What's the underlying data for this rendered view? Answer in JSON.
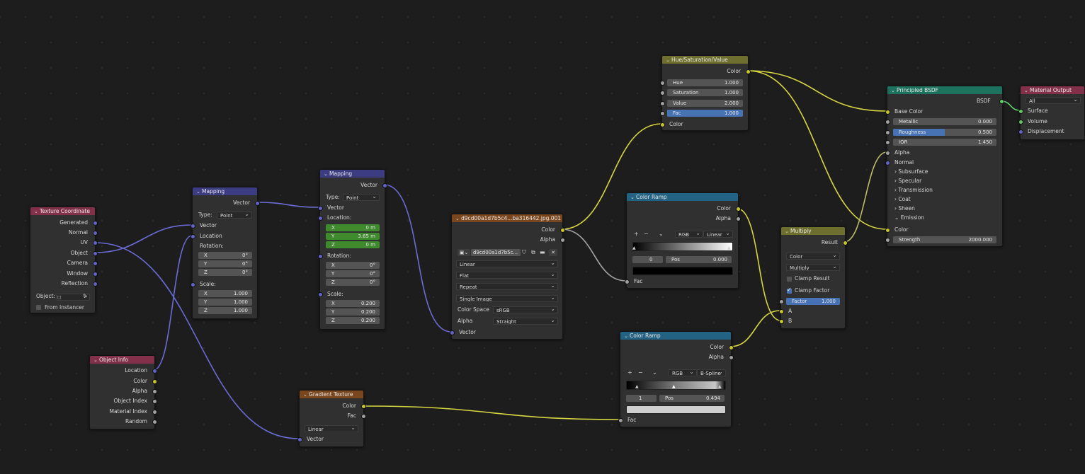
{
  "nodes": {
    "texcoord": {
      "title": "Texture Coordinate",
      "outputs": [
        "Generated",
        "Normal",
        "UV",
        "Object",
        "Camera",
        "Window",
        "Reflection"
      ],
      "object_label": "Object:",
      "from_instancer": "From Instancer"
    },
    "objinfo": {
      "title": "Object Info",
      "outputs": [
        "Location",
        "Color",
        "Alpha",
        "Object Index",
        "Material Index",
        "Random"
      ]
    },
    "mapping1": {
      "title": "Mapping",
      "out_vector": "Vector",
      "type_label": "Type:",
      "type_value": "Point",
      "in_vector": "Vector",
      "location": "Location",
      "rotation": "Rotation:",
      "rot": {
        "x": "0°",
        "y": "0°",
        "z": "0°"
      },
      "scale_label": "Scale:",
      "scale": {
        "x": "1.000",
        "y": "1.000",
        "z": "1.000"
      }
    },
    "mapping2": {
      "title": "Mapping",
      "out_vector": "Vector",
      "type_label": "Type:",
      "type_value": "Point",
      "in_vector": "Vector",
      "location": "Location:",
      "loc": {
        "x": "0 m",
        "y": "3.65 m",
        "z": "0 m"
      },
      "rotation": "Rotation:",
      "rot": {
        "x": "0°",
        "y": "0°",
        "z": "0°"
      },
      "scale_label": "Scale:",
      "scale": {
        "x": "0.200",
        "y": "0.200",
        "z": "0.200"
      }
    },
    "image": {
      "title": "d9cd00a1d7b5c4...ba316442.jpg.001",
      "out_color": "Color",
      "out_alpha": "Alpha",
      "image_name": "d9cd00a1d7b5c...",
      "interpolation": "Linear",
      "projection": "Flat",
      "extension": "Repeat",
      "source": "Single Image",
      "colorspace_label": "Color Space",
      "colorspace": "sRGB",
      "alpha_label": "Alpha",
      "alpha": "Straight",
      "in_vector": "Vector"
    },
    "gradient": {
      "title": "Gradient Texture",
      "out_color": "Color",
      "out_fac": "Fac",
      "type": "Linear",
      "in_vector": "Vector"
    },
    "hsv": {
      "title": "Hue/Saturation/Value",
      "out_color": "Color",
      "hue_label": "Hue",
      "hue": "1.000",
      "sat_label": "Saturation",
      "sat": "1.000",
      "val_label": "Value",
      "val": "2.000",
      "fac_label": "Fac",
      "fac": "1.000",
      "in_color": "Color"
    },
    "ramp1": {
      "title": "Color Ramp",
      "out_color": "Color",
      "out_alpha": "Alpha",
      "mode": "RGB",
      "interp": "Linear",
      "stop_index": "0",
      "pos_label": "Pos",
      "pos": "0.000",
      "in_fac": "Fac",
      "swatch_color": "#000000"
    },
    "ramp2": {
      "title": "Color Ramp",
      "out_color": "Color",
      "out_alpha": "Alpha",
      "mode": "RGB",
      "interp": "B-Spline",
      "stop_index": "1",
      "pos_label": "Pos",
      "pos": "0.494",
      "in_fac": "Fac",
      "swatch_color": "#cfcfcf"
    },
    "multiply": {
      "title": "Multiply",
      "out_result": "Result",
      "data_type": "Color",
      "blend": "Multiply",
      "clamp_result": "Clamp Result",
      "clamp_factor": "Clamp Factor",
      "factor_label": "Factor",
      "factor": "1.000",
      "in_a": "A",
      "in_b": "B"
    },
    "bsdf": {
      "title": "Principled BSDF",
      "out_bsdf": "BSDF",
      "base_color": "Base Color",
      "metallic_label": "Metallic",
      "metallic": "0.000",
      "roughness_label": "Roughness",
      "roughness": "0.500",
      "roughness_fill": 0.5,
      "ior_label": "IOR",
      "ior": "1.450",
      "alpha": "Alpha",
      "normal": "Normal",
      "panels": [
        "Subsurface",
        "Specular",
        "Transmission",
        "Coat",
        "Sheen"
      ],
      "emission": "Emission",
      "em_color": "Color",
      "strength_label": "Strength",
      "strength": "2000.000"
    },
    "output": {
      "title": "Material Output",
      "target": "All",
      "inputs": [
        "Surface",
        "Volume",
        "Displacement"
      ]
    }
  },
  "colors": {
    "vector_socket": "#6363c7",
    "color_socket": "#c7c729",
    "float_socket": "#a1a1a1",
    "shader_socket": "#63c763",
    "wire_vector": "#6b6bd6",
    "wire_color": "#d6d641",
    "wire_float": "#a5a5a5",
    "wire_shader": "#62d66d",
    "active_field": "#4772b3"
  }
}
